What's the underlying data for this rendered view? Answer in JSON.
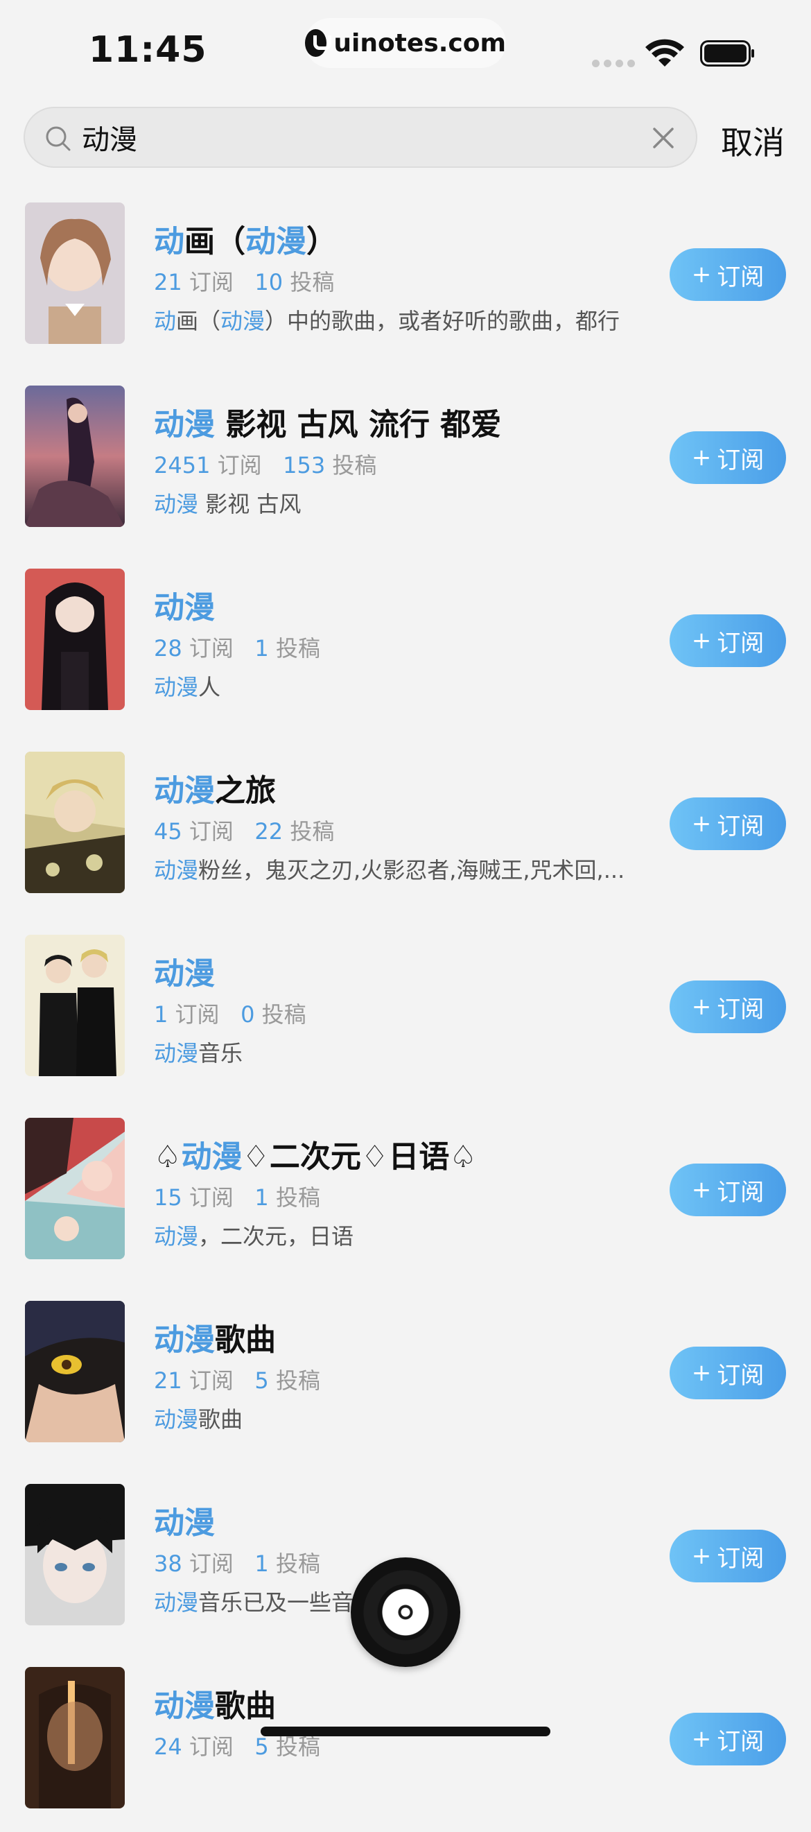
{
  "status_bar": {
    "time": "11:45",
    "url": "uinotes.com"
  },
  "search": {
    "value": "动漫",
    "cancel_label": "取消"
  },
  "results": [
    {
      "title_parts": [
        [
          "动",
          1
        ],
        [
          "画（",
          0
        ],
        [
          "动漫",
          1
        ],
        [
          "）",
          0
        ]
      ],
      "subs": "21",
      "subs_label": "订阅",
      "posts": "10",
      "posts_label": "投稿",
      "desc_parts": [
        [
          "动",
          1
        ],
        [
          "画（",
          0
        ],
        [
          "动漫",
          1
        ],
        [
          "）中的歌曲，或者好听的歌曲，都行",
          0
        ]
      ],
      "button": "订阅"
    },
    {
      "title_parts": [
        [
          "动漫",
          1
        ],
        [
          " 影视 古风 流行 都爱",
          0
        ]
      ],
      "subs": "2451",
      "subs_label": "订阅",
      "posts": "153",
      "posts_label": "投稿",
      "desc_parts": [
        [
          "动漫",
          1
        ],
        [
          " 影视 古风",
          0
        ]
      ],
      "button": "订阅"
    },
    {
      "title_parts": [
        [
          "动漫",
          1
        ]
      ],
      "subs": "28",
      "subs_label": "订阅",
      "posts": "1",
      "posts_label": "投稿",
      "desc_parts": [
        [
          "动漫",
          1
        ],
        [
          "人",
          0
        ]
      ],
      "button": "订阅"
    },
    {
      "title_parts": [
        [
          "动漫",
          1
        ],
        [
          "之旅",
          0
        ]
      ],
      "subs": "45",
      "subs_label": "订阅",
      "posts": "22",
      "posts_label": "投稿",
      "desc_parts": [
        [
          "动漫",
          1
        ],
        [
          "粉丝，鬼灭之刃,火影忍者,海贼王,咒术回,...",
          0
        ]
      ],
      "button": "订阅"
    },
    {
      "title_parts": [
        [
          "动漫",
          1
        ]
      ],
      "subs": "1",
      "subs_label": "订阅",
      "posts": "0",
      "posts_label": "投稿",
      "desc_parts": [
        [
          "动漫",
          1
        ],
        [
          "音乐",
          0
        ]
      ],
      "button": "订阅"
    },
    {
      "title_parts": [
        [
          "♤",
          0
        ],
        [
          "动漫",
          1
        ],
        [
          "♢二次元♢日语♤",
          0
        ]
      ],
      "subs": "15",
      "subs_label": "订阅",
      "posts": "1",
      "posts_label": "投稿",
      "desc_parts": [
        [
          "动漫",
          1
        ],
        [
          "，二次元，日语",
          0
        ]
      ],
      "button": "订阅"
    },
    {
      "title_parts": [
        [
          "动漫",
          1
        ],
        [
          "歌曲",
          0
        ]
      ],
      "subs": "21",
      "subs_label": "订阅",
      "posts": "5",
      "posts_label": "投稿",
      "desc_parts": [
        [
          "动漫",
          1
        ],
        [
          "歌曲",
          0
        ]
      ],
      "button": "订阅"
    },
    {
      "title_parts": [
        [
          "动漫",
          1
        ]
      ],
      "subs": "38",
      "subs_label": "订阅",
      "posts": "1",
      "posts_label": "投稿",
      "desc_parts": [
        [
          "动漫",
          1
        ],
        [
          "音乐已及一些音",
          0
        ]
      ],
      "button": "订阅"
    },
    {
      "title_parts": [
        [
          "动漫",
          1
        ],
        [
          "歌曲",
          0
        ]
      ],
      "subs": "24",
      "subs_label": "订阅",
      "posts": "5",
      "posts_label": "投稿",
      "desc_parts": [],
      "button": "订阅"
    }
  ],
  "colors": {
    "highlight": "#4c9be0",
    "button_start": "#6fc3f6",
    "button_end": "#4a9ee8",
    "background": "#f3f3f3"
  },
  "icons": {
    "search": "search-icon",
    "clear": "clear-icon",
    "now_playing": "vinyl-record-icon"
  }
}
